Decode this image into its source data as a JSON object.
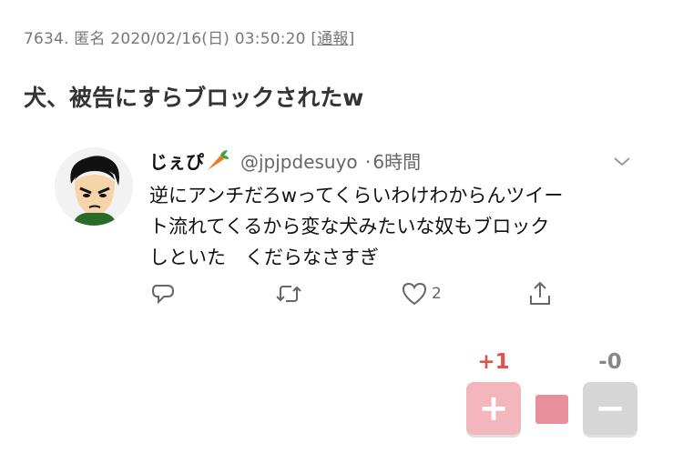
{
  "post": {
    "number": "7634.",
    "author": "匿名",
    "datetime": "2020/02/16(日) 03:50:20",
    "report_open": "[",
    "report_label": "通報",
    "report_close": "]",
    "title": "犬、被告にすらブロックされたw"
  },
  "tweet": {
    "name": "じぇぴ",
    "name_icon": "carrot-emoji",
    "handle": "@jpjpdesuyo",
    "separator": "·",
    "time": "6時間",
    "text_lines": [
      "逆にアンチだろwってくらいわけわからんツイー",
      "ト流れてくるから変な犬みたいな奴もブロック",
      "しといた　くだらなさすぎ"
    ],
    "like_count": "2",
    "icons": [
      "reply-icon",
      "retweet-icon",
      "like-icon",
      "share-icon",
      "chevron-down-icon"
    ]
  },
  "votes": {
    "plus_count": "+1",
    "minus_count": "-0",
    "plus_label": "+",
    "minus_label": "−",
    "plus_color": "#f4b6bd",
    "minus_color": "#d6d6d6",
    "ratio_color": "#e8909a",
    "plus_ratio": 1.0
  }
}
